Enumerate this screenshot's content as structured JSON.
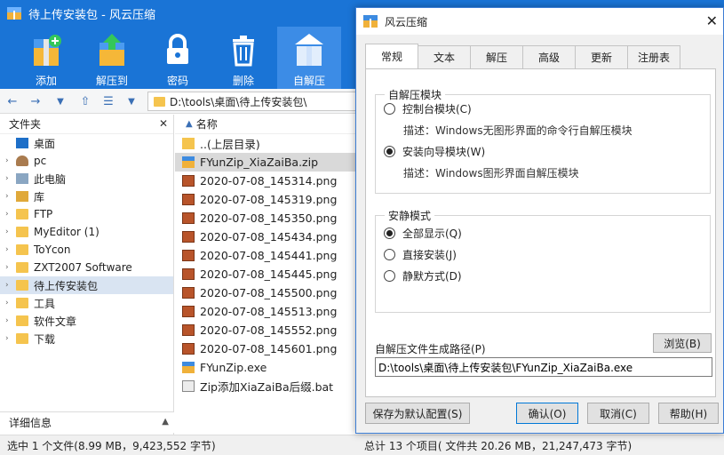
{
  "colors": {
    "accent": "#1a74d6",
    "toolbar_active": "#3c8ce6"
  },
  "main": {
    "title": "待上传安装包 - 风云压缩",
    "toolbar": [
      {
        "label": "添加",
        "icon": "add-archive-icon"
      },
      {
        "label": "解压到",
        "icon": "extract-icon"
      },
      {
        "label": "密码",
        "icon": "lock-icon"
      },
      {
        "label": "删除",
        "icon": "trash-icon"
      },
      {
        "label": "自解压",
        "icon": "self-extract-icon"
      }
    ],
    "path": "D:\\tools\\桌面\\待上传安装包\\",
    "left_panel": {
      "header": "文件夹",
      "items": [
        {
          "label": "桌面",
          "icon": "desktop"
        },
        {
          "label": "pc",
          "icon": "user"
        },
        {
          "label": "此电脑",
          "icon": "pc"
        },
        {
          "label": "库",
          "icon": "lib"
        },
        {
          "label": "FTP",
          "icon": "folder"
        },
        {
          "label": "MyEditor (1)",
          "icon": "folder"
        },
        {
          "label": "ToYcon",
          "icon": "folder"
        },
        {
          "label": "ZXT2007 Software",
          "icon": "folder"
        },
        {
          "label": "待上传安装包",
          "icon": "folder"
        },
        {
          "label": "工具",
          "icon": "folder"
        },
        {
          "label": "软件文章",
          "icon": "folder"
        },
        {
          "label": "下载",
          "icon": "folder"
        }
      ],
      "detail_label": "详细信息"
    },
    "file_list": {
      "column_header": "名称",
      "files": [
        {
          "name": "..(上层目录)",
          "type": "folder"
        },
        {
          "name": "FYunZip_XiaZaiBa.zip",
          "type": "zip"
        },
        {
          "name": "2020-07-08_145314.png",
          "type": "png"
        },
        {
          "name": "2020-07-08_145319.png",
          "type": "png"
        },
        {
          "name": "2020-07-08_145350.png",
          "type": "png"
        },
        {
          "name": "2020-07-08_145434.png",
          "type": "png"
        },
        {
          "name": "2020-07-08_145441.png",
          "type": "png"
        },
        {
          "name": "2020-07-08_145445.png",
          "type": "png"
        },
        {
          "name": "2020-07-08_145500.png",
          "type": "png"
        },
        {
          "name": "2020-07-08_145513.png",
          "type": "png"
        },
        {
          "name": "2020-07-08_145552.png",
          "type": "png"
        },
        {
          "name": "2020-07-08_145601.png",
          "type": "png"
        },
        {
          "name": "FYunZip.exe",
          "type": "exe"
        },
        {
          "name": "Zip添加XiaZaiBa后缀.bat",
          "type": "bat"
        }
      ]
    },
    "status_left": "选中 1 个文件(8.99 MB，9,423,552 字节)",
    "status_right": "总计 13 个项目( 文件共 20.26 MB，21,247,473 字节)"
  },
  "dialog": {
    "title": "风云压缩",
    "tabs": [
      "常规",
      "文本",
      "解压",
      "高级",
      "更新",
      "注册表"
    ],
    "group1": {
      "legend": "自解压模块",
      "option1": "控制台模块(C)",
      "desc1": "描述：Windows无图形界面的命令行自解压模块",
      "option2": "安装向导模块(W)",
      "desc2": "描述：Windows图形界面自解压模块"
    },
    "group2": {
      "legend": "安静模式",
      "option1": "全部显示(Q)",
      "option2": "直接安装(J)",
      "option3": "静默方式(D)"
    },
    "path_label": "自解压文件生成路径(P)",
    "browse_label": "浏览(B)",
    "output_path": "D:\\tools\\桌面\\待上传安装包\\FYunZip_XiaZaiBa.exe",
    "buttons": {
      "save_default": "保存为默认配置(S)",
      "ok": "确认(O)",
      "cancel": "取消(C)",
      "help": "帮助(H)"
    }
  }
}
